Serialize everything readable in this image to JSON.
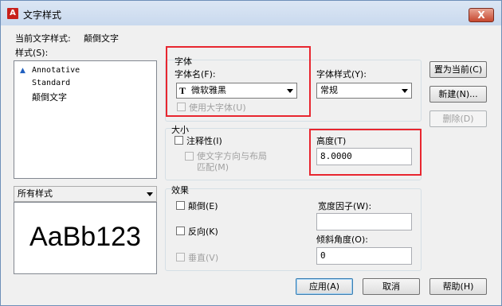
{
  "window": {
    "title": "文字样式",
    "close_label": "X",
    "app_icon": "autocad-logo-icon"
  },
  "current_style": {
    "label": "当前文字样式:",
    "value": "颠倒文字"
  },
  "styles": {
    "label": "样式(S):",
    "items": [
      {
        "label": "Annotative",
        "icon": "annotative-icon"
      },
      {
        "label": "Standard"
      },
      {
        "label": "颠倒文字"
      }
    ],
    "filter": "所有样式"
  },
  "font": {
    "group_label": "字体",
    "name_label": "字体名(F):",
    "name_value": "微软雅黑",
    "name_icon": "truetype-icon",
    "style_label": "字体样式(Y):",
    "style_value": "常规",
    "bigfont_label": "使用大字体(U)"
  },
  "size": {
    "group_label": "大小",
    "annotative_label": "注释性(I)",
    "match_orientation_line1": "使文字方向与布局",
    "match_orientation_line2": "匹配(M)",
    "height_label": "高度(T)",
    "height_value": "8.0000"
  },
  "effects": {
    "group_label": "效果",
    "upside_down_label": "颠倒(E)",
    "backwards_label": "反向(K)",
    "vertical_label": "垂直(V)",
    "width_factor_label": "宽度因子(W):",
    "width_factor_value": "",
    "oblique_label": "倾斜角度(O):",
    "oblique_value": "0"
  },
  "preview": {
    "text": "AaBb123"
  },
  "buttons": {
    "set_current": "置为当前(C)",
    "new": "新建(N)...",
    "delete": "删除(D)",
    "apply": "应用(A)",
    "cancel": "取消",
    "help": "帮助(H)"
  },
  "highlight_color": "#e8262f"
}
